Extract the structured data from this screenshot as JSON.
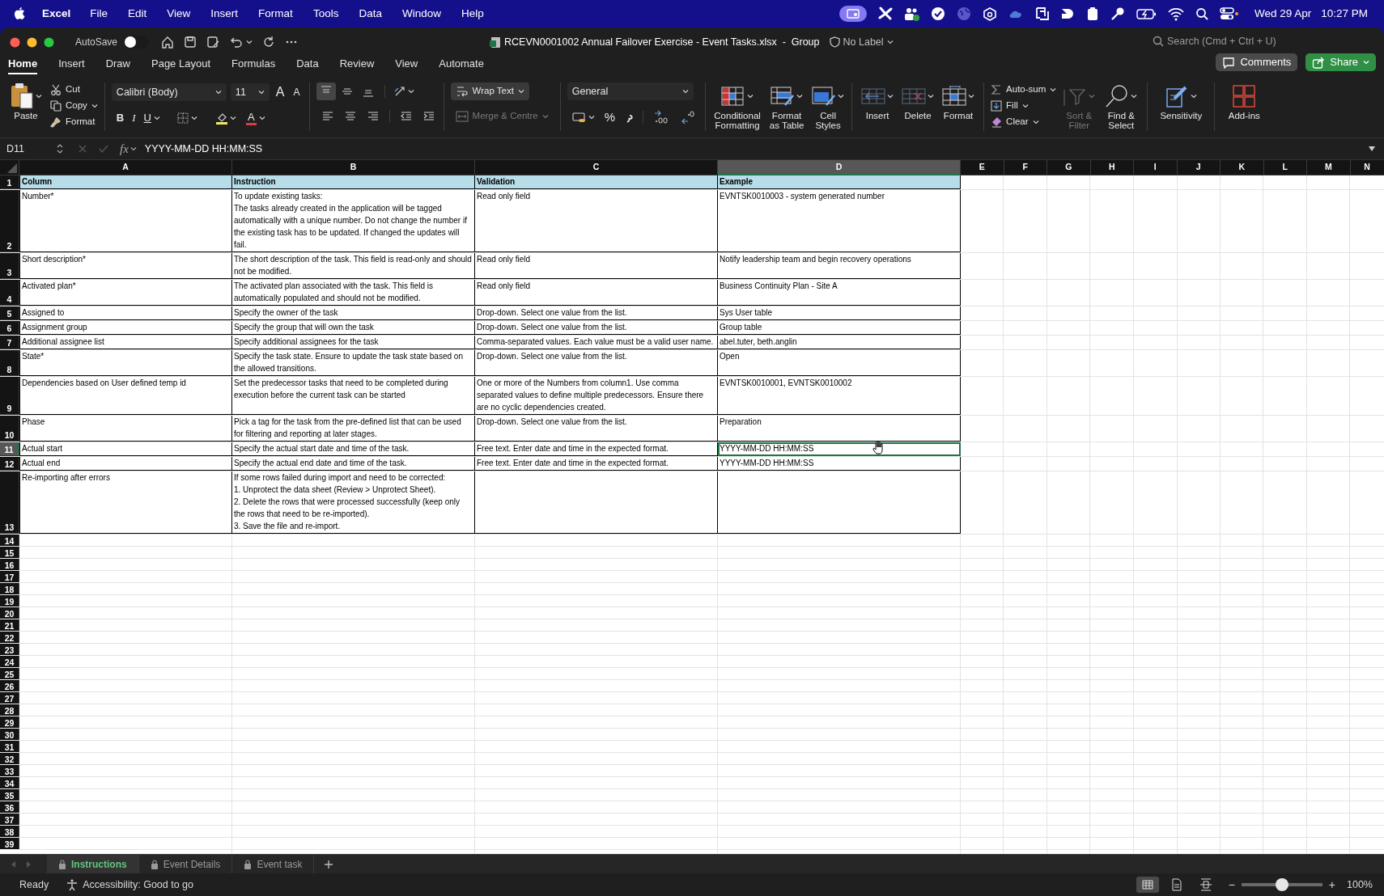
{
  "menubar": {
    "app": "Excel",
    "menus": [
      "File",
      "Edit",
      "View",
      "Insert",
      "Format",
      "Tools",
      "Data",
      "Window",
      "Help"
    ],
    "date": "Wed 29 Apr",
    "time": "10:27 PM"
  },
  "window": {
    "autosave": {
      "label": "AutoSave",
      "on": false
    },
    "title": "RCEVN0001002 Annual Failover Exercise - Event Tasks.xlsx  -  Group",
    "sensitivity": "No Label",
    "search": {
      "placeholder": "Search (Cmd + Ctrl + U)"
    }
  },
  "ribbon_tabs": [
    {
      "label": "Home",
      "selected": true
    },
    {
      "label": "Insert",
      "selected": false
    },
    {
      "label": "Draw",
      "selected": false
    },
    {
      "label": "Page Layout",
      "selected": false
    },
    {
      "label": "Formulas",
      "selected": false
    },
    {
      "label": "Data",
      "selected": false
    },
    {
      "label": "Review",
      "selected": false
    },
    {
      "label": "View",
      "selected": false
    },
    {
      "label": "Automate",
      "selected": false
    }
  ],
  "comments": "Comments",
  "share": "Share",
  "ribbon": {
    "paste": "Paste",
    "cut": "Cut",
    "copy": "Copy",
    "format_painter": "Format",
    "font": "Calibri (Body)",
    "font_size": "11",
    "grow_font": "A",
    "shrink_font": "A",
    "bold": "B",
    "italic": "I",
    "underline": "U",
    "font_color": "A",
    "vertical_align": [
      {
        "kind": "top",
        "selected": true
      },
      {
        "kind": "middle",
        "selected": false
      },
      {
        "kind": "bottom",
        "selected": false
      }
    ],
    "wrap_text": {
      "label": "Wrap Text",
      "selected": true
    },
    "merge": {
      "label": "Merge & Centre",
      "disabled": true
    },
    "number_format": "General",
    "percent": "%",
    "conditional_formatting": "Conditional Formatting",
    "format_as_table": "Format as Table",
    "cell_styles": "Cell Styles",
    "insert": "Insert",
    "delete": "Delete",
    "format": "Format",
    "autosum": "Auto-sum",
    "fill": "Fill",
    "clear": "Clear",
    "sort_filter": {
      "label": "Sort & Filter",
      "disabled": true
    },
    "find_select": "Find & Select",
    "sensitivity": "Sensitivity",
    "add_ins": "Add-ins"
  },
  "formula_bar": {
    "cell": "D11",
    "fx": "fx",
    "formula": "YYYY-MM-DD HH:MM:SS"
  },
  "sheet": {
    "columns": [
      {
        "label": "A",
        "selected": false
      },
      {
        "label": "B",
        "selected": false
      },
      {
        "label": "C",
        "selected": false
      },
      {
        "label": "D",
        "selected": true
      },
      {
        "label": "E",
        "selected": false
      },
      {
        "label": "F",
        "selected": false
      },
      {
        "label": "G",
        "selected": false
      },
      {
        "label": "H",
        "selected": false
      },
      {
        "label": "I",
        "selected": false
      },
      {
        "label": "J",
        "selected": false
      },
      {
        "label": "K",
        "selected": false
      },
      {
        "label": "L",
        "selected": false
      },
      {
        "label": "M",
        "selected": false
      },
      {
        "label": "N",
        "selected": false
      }
    ],
    "rows": [
      {
        "number": "1",
        "kind": "header",
        "selected": false,
        "cells": [
          {
            "text": "Column",
            "selected": false
          },
          {
            "text": "Instruction",
            "selected": false
          },
          {
            "text": "Validation",
            "selected": false
          },
          {
            "text": "Example",
            "selected": false
          }
        ]
      },
      {
        "number": "2",
        "kind": "body",
        "selected": false,
        "cells": [
          {
            "text": "Number*",
            "selected": false
          },
          {
            "text": "To update existing tasks:\nThe tasks already created in the application will be tagged automatically with a unique number. Do not change the number if the existing task has to be updated. If changed the updates will fail.",
            "selected": false
          },
          {
            "text": "Read only field",
            "selected": false
          },
          {
            "text": "EVNTSK0010003 - system generated number",
            "selected": false
          }
        ]
      },
      {
        "number": "3",
        "kind": "body",
        "selected": false,
        "cells": [
          {
            "text": "Short description*",
            "selected": false
          },
          {
            "text": "The short description of the task. This field is read-only and should not be modified.",
            "selected": false
          },
          {
            "text": "Read only field",
            "selected": false
          },
          {
            "text": "Notify leadership team and begin recovery operations",
            "selected": false
          }
        ]
      },
      {
        "number": "4",
        "kind": "body",
        "selected": false,
        "cells": [
          {
            "text": "Activated plan*",
            "selected": false
          },
          {
            "text": "The activated plan associated with the task. This field is automatically populated and should not be modified.",
            "selected": false
          },
          {
            "text": "Read only field",
            "selected": false
          },
          {
            "text": "Business Continuity Plan - Site A",
            "selected": false
          }
        ]
      },
      {
        "number": "5",
        "kind": "body",
        "selected": false,
        "cells": [
          {
            "text": "Assigned to",
            "selected": false
          },
          {
            "text": "Specify the owner of the task",
            "selected": false
          },
          {
            "text": "Drop-down. Select one value from the list.",
            "selected": false
          },
          {
            "text": "Sys User table",
            "selected": false
          }
        ]
      },
      {
        "number": "6",
        "kind": "body",
        "selected": false,
        "cells": [
          {
            "text": "Assignment group",
            "selected": false
          },
          {
            "text": "Specify the group that will own the task",
            "selected": false
          },
          {
            "text": "Drop-down. Select one value from the list.",
            "selected": false
          },
          {
            "text": "Group table",
            "selected": false
          }
        ]
      },
      {
        "number": "7",
        "kind": "body",
        "selected": false,
        "cells": [
          {
            "text": "Additional assignee list",
            "selected": false
          },
          {
            "text": "Specify additional assignees for the task",
            "selected": false
          },
          {
            "text": "Comma-separated values. Each value must be a valid user name.",
            "selected": false
          },
          {
            "text": "abel.tuter, beth.anglin",
            "selected": false
          }
        ]
      },
      {
        "number": "8",
        "kind": "body",
        "selected": false,
        "cells": [
          {
            "text": "State*",
            "selected": false
          },
          {
            "text": "Specify the task state. Ensure to update the task state based on the allowed transitions.",
            "selected": false
          },
          {
            "text": "Drop-down. Select one value from the list.",
            "selected": false
          },
          {
            "text": "Open",
            "selected": false
          }
        ]
      },
      {
        "number": "9",
        "kind": "body",
        "selected": false,
        "cells": [
          {
            "text": "Dependencies based on User defined temp id",
            "selected": false
          },
          {
            "text": "Set the predecessor tasks that need to be completed during execution before the current task can be started",
            "selected": false
          },
          {
            "text": "One or more of the Numbers from column1. Use comma separated values to define multiple predecessors. Ensure there are no cyclic dependencies created.",
            "selected": false
          },
          {
            "text": "EVNTSK0010001, EVNTSK0010002",
            "selected": false
          }
        ]
      },
      {
        "number": "10",
        "kind": "body",
        "selected": false,
        "cells": [
          {
            "text": "Phase",
            "selected": false
          },
          {
            "text": "Pick a tag for the task from the pre-defined list that can be used for filtering and reporting at later stages.",
            "selected": false
          },
          {
            "text": "Drop-down. Select one value from the list.",
            "selected": false
          },
          {
            "text": "Preparation",
            "selected": false
          }
        ]
      },
      {
        "number": "11",
        "kind": "body",
        "selected": true,
        "cells": [
          {
            "text": "Actual start",
            "selected": false
          },
          {
            "text": "Specify the actual start date and time of the task.",
            "selected": false
          },
          {
            "text": "Free text. Enter date and time in the expected format.",
            "selected": false
          },
          {
            "text": "YYYY-MM-DD HH:MM:SS",
            "selected": true
          }
        ]
      },
      {
        "number": "12",
        "kind": "body",
        "selected": false,
        "cells": [
          {
            "text": "Actual end",
            "selected": false
          },
          {
            "text": "Specify the actual end date and time of the task.",
            "selected": false
          },
          {
            "text": "Free text. Enter date and time in the expected format.",
            "selected": false
          },
          {
            "text": "YYYY-MM-DD HH:MM:SS",
            "selected": false
          }
        ]
      },
      {
        "number": "13",
        "kind": "body",
        "selected": false,
        "cells": [
          {
            "text": "Re-importing after errors",
            "selected": false
          },
          {
            "text": "If some rows failed during import and need to be corrected:\n1. Unprotect the data sheet (Review > Unprotect Sheet).\n2. Delete the rows that were processed successfully (keep only the rows that need to be re-imported).\n3. Save the file and re-import.",
            "selected": false
          },
          {
            "text": "",
            "selected": false
          },
          {
            "text": "",
            "selected": false
          }
        ]
      }
    ],
    "empty_rows": [
      "14",
      "15",
      "16",
      "17",
      "18",
      "19",
      "20",
      "21",
      "22",
      "23",
      "24",
      "25",
      "26",
      "27",
      "28",
      "29",
      "30",
      "31",
      "32",
      "33",
      "34",
      "35",
      "36",
      "37",
      "38",
      "39"
    ]
  },
  "sheet_tabs": [
    {
      "label": "Instructions",
      "selected": true,
      "locked": true
    },
    {
      "label": "Event Details",
      "selected": false,
      "locked": true
    },
    {
      "label": "Event task",
      "selected": false,
      "locked": true
    }
  ],
  "status": {
    "ready": "Ready",
    "accessibility": "Accessibility: Good to go",
    "views": [
      {
        "kind": "normal",
        "selected": true
      },
      {
        "kind": "page_layout",
        "selected": false
      },
      {
        "kind": "page_break",
        "selected": false
      }
    ],
    "zoom": {
      "out": "−",
      "level": 0.5,
      "in": "+",
      "reading": "100%"
    }
  }
}
